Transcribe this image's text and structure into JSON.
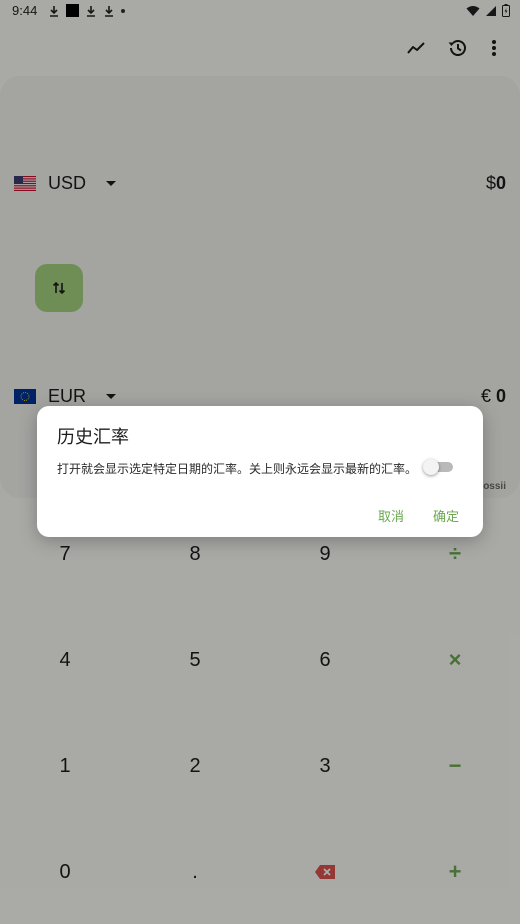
{
  "status_bar": {
    "time": "9:44"
  },
  "top_actions": [
    "trend-icon",
    "history-icon",
    "more-vert-icon"
  ],
  "converter": {
    "from": {
      "code": "USD",
      "symbol": "$",
      "amount": "0"
    },
    "to": {
      "code": "EUR",
      "symbol": "€",
      "amount": "0"
    },
    "provider_partial": "ossii"
  },
  "keypad": {
    "rows": [
      [
        "7",
        "8",
        "9",
        "÷"
      ],
      [
        "4",
        "5",
        "6",
        "×"
      ],
      [
        "1",
        "2",
        "3",
        "−"
      ],
      [
        "0",
        ".",
        "backspace-icon",
        "+"
      ]
    ]
  },
  "dialog": {
    "title": "历史汇率",
    "message": "打开就会显示选定特定日期的汇率。关上则永远会显示最新的汇率。",
    "switch_on": false,
    "cancel_label": "取消",
    "confirm_label": "确定"
  },
  "colors": {
    "accent": "#6aa84f",
    "swap_button": "#a4d27f",
    "backspace": "#d9534f"
  }
}
